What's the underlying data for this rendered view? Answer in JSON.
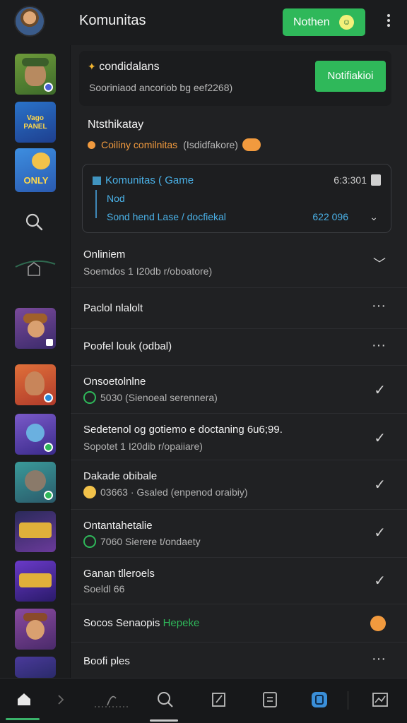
{
  "header": {
    "title": "Komunitas",
    "notify_label": "Nothen",
    "notify_badge": "☺"
  },
  "top_card": {
    "title": "condidalans",
    "subtitle": "Sooriniaod ancoriob  bg eef2268)",
    "button": "Notifiakioi"
  },
  "section": {
    "title": "Ntsthikatay",
    "sub_accent": "Coiliny comilnitas",
    "sub_muted": "(Isdidfakore)"
  },
  "game_card": {
    "title": "Komunitas ( Game",
    "time": "6:3:301",
    "sub": "Nod",
    "link": "Sond hend Lase / docfiekal",
    "count": "622 096"
  },
  "rows": [
    {
      "title": "Onliniem",
      "sub": "Soemdos 1 I20db   r/oboatore)",
      "action": "chevron"
    },
    {
      "title": "Paclol nlalolt",
      "sub": "",
      "action": "dots"
    },
    {
      "title": "Poofel louk (odbal)",
      "sub": "",
      "action": "dots"
    },
    {
      "title": "Onsoetolnlne",
      "sub": "5030  (Sienoeal serennera)",
      "action": "check"
    },
    {
      "title": "Sedetenol og gotiemo e doctaning 6u6;99.",
      "sub": "Sopotet 1 I20dib r/opaiiare)",
      "action": "check"
    },
    {
      "title": "Dakade obibale",
      "sub": "03663 · Gsaled (enpenod oraibiy)",
      "action": "check"
    },
    {
      "title": "Ontantahetalie",
      "sub": "7060  Sierere t/ondaety",
      "action": "check"
    },
    {
      "title": "Ganan tlleroels",
      "sub": "Soeldl 66",
      "action": "check"
    },
    {
      "title": "Socos Senaopis",
      "title_accent": "Hepeke",
      "sub": "",
      "action": "badge"
    },
    {
      "title": "Boofi ples",
      "sub": "",
      "action": "dots"
    }
  ],
  "sidebar_badge_text": "Vago PANEL",
  "sidebar_badge_text2": "ONLY",
  "colors": {
    "accent_green": "#2fb85a",
    "accent_blue": "#4ab1e7",
    "accent_orange": "#f19a3e",
    "background": "#1b1c1e"
  }
}
